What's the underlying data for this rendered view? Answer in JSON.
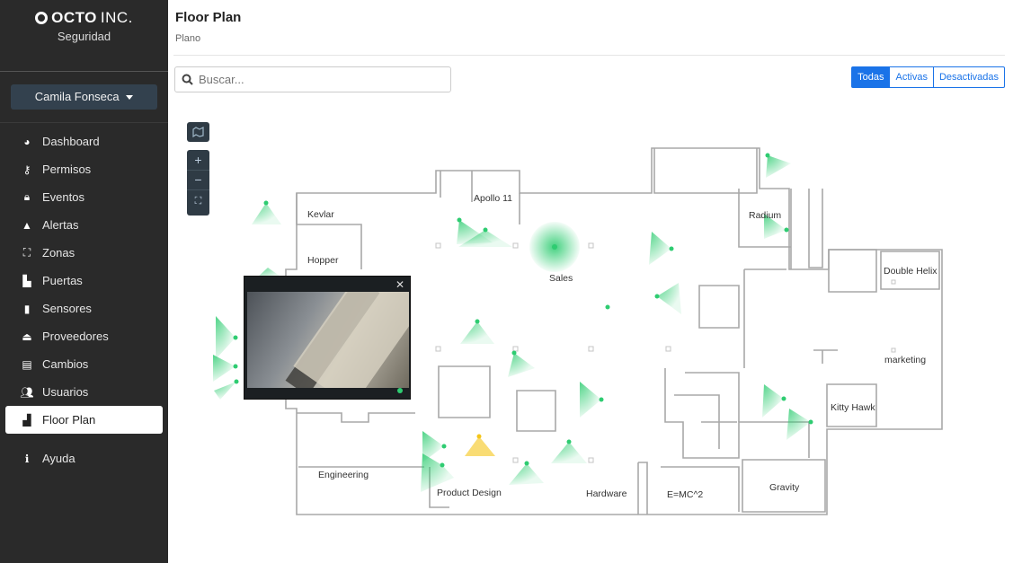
{
  "brand": {
    "name": "OCTO",
    "suffix": "INC.",
    "subtitle": "Seguridad"
  },
  "user": {
    "name": "Camila Fonseca"
  },
  "nav": [
    {
      "label": "Dashboard",
      "icon": "dashboard-icon",
      "glyph": "◕"
    },
    {
      "label": "Permisos",
      "icon": "key-icon",
      "glyph": "⚷"
    },
    {
      "label": "Eventos",
      "icon": "lock-icon",
      "glyph": "🔒︎"
    },
    {
      "label": "Alertas",
      "icon": "warning-icon",
      "glyph": "▲"
    },
    {
      "label": "Zonas",
      "icon": "zones-icon",
      "glyph": "⛶"
    },
    {
      "label": "Puertas",
      "icon": "door-icon",
      "glyph": "▙"
    },
    {
      "label": "Sensores",
      "icon": "sensor-icon",
      "glyph": "▮"
    },
    {
      "label": "Proveedores",
      "icon": "truck-icon",
      "glyph": "⏏"
    },
    {
      "label": "Cambios",
      "icon": "clipboard-icon",
      "glyph": "▤"
    },
    {
      "label": "Usuarios",
      "icon": "users-icon",
      "glyph": "👥︎"
    },
    {
      "label": "Floor Plan",
      "icon": "floorplan-icon",
      "glyph": "▟",
      "active": true
    },
    {
      "label": "Ayuda",
      "icon": "info-icon",
      "glyph": "ℹ"
    }
  ],
  "header": {
    "title": "Floor Plan",
    "subtitle": "Plano"
  },
  "search": {
    "placeholder": "Buscar..."
  },
  "filters": {
    "all": "Todas",
    "active": "Activas",
    "inactive": "Desactivadas",
    "selected": "Todas"
  },
  "rooms": [
    "Kevlar",
    "Apollo 11",
    "Radium",
    "Hopper",
    "Sales",
    "Double Helix",
    "marketing",
    "Kitty Hawk",
    "Engineering",
    "Product Design",
    "Hardware",
    "E=MC^2",
    "Gravity"
  ],
  "colors": {
    "sidebar": "#2a2a2a",
    "accent": "#1a73e8",
    "camera_active": "#2ecc71",
    "camera_warning": "#f5c518",
    "map_wall": "#9a9a9a"
  }
}
